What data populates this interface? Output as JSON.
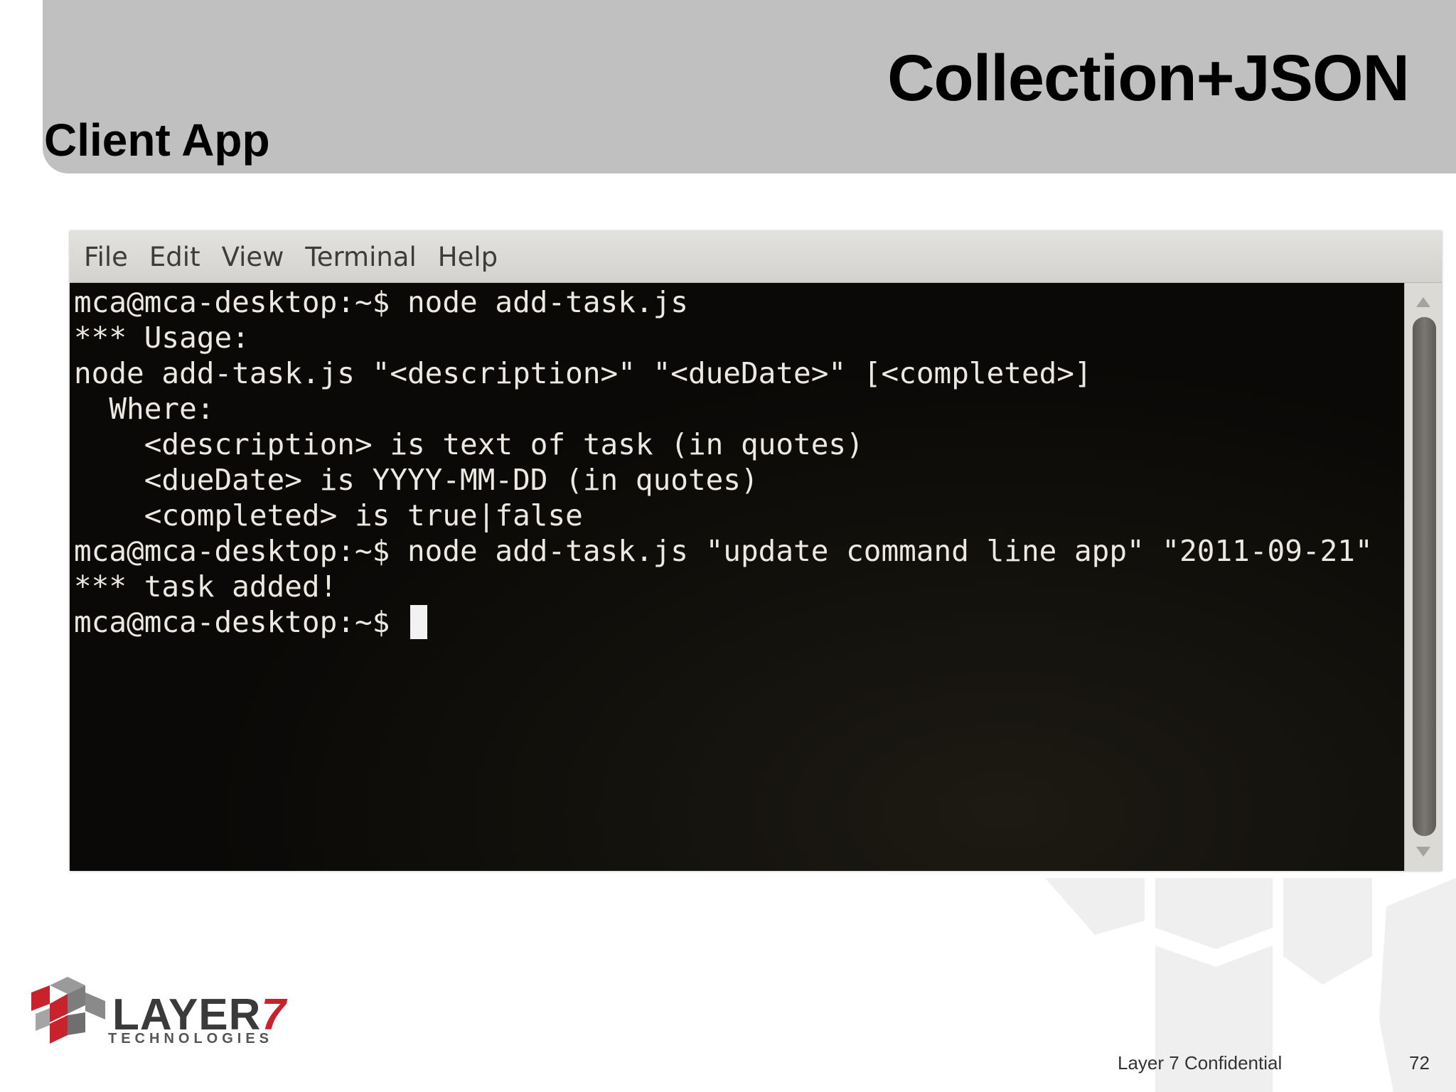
{
  "slide": {
    "title": "Collection+JSON",
    "subtitle": "Client App"
  },
  "terminal": {
    "menu": [
      "File",
      "Edit",
      "View",
      "Terminal",
      "Help"
    ],
    "lines": [
      "mca@mca-desktop:~$ node add-task.js",
      "*** Usage:",
      "node add-task.js \"<description>\" \"<dueDate>\" [<completed>]",
      "  Where:",
      "    <description> is text of task (in quotes)",
      "    <dueDate> is YYYY-MM-DD (in quotes)",
      "    <completed> is true|false",
      "mca@mca-desktop:~$ node add-task.js \"update command line app\" \"2011-09-21\"",
      "*** task added!",
      "mca@mca-desktop:~$ "
    ]
  },
  "logo": {
    "word": "LAYER",
    "number": "7",
    "tagline": "TECHNOLOGIES"
  },
  "footer": {
    "confidential": "Layer 7 Confidential",
    "page_number": "72"
  },
  "colors": {
    "header_bg": "#c0c0c0",
    "terminal_bg": "#0b0907",
    "logo_red": "#c8232c"
  }
}
